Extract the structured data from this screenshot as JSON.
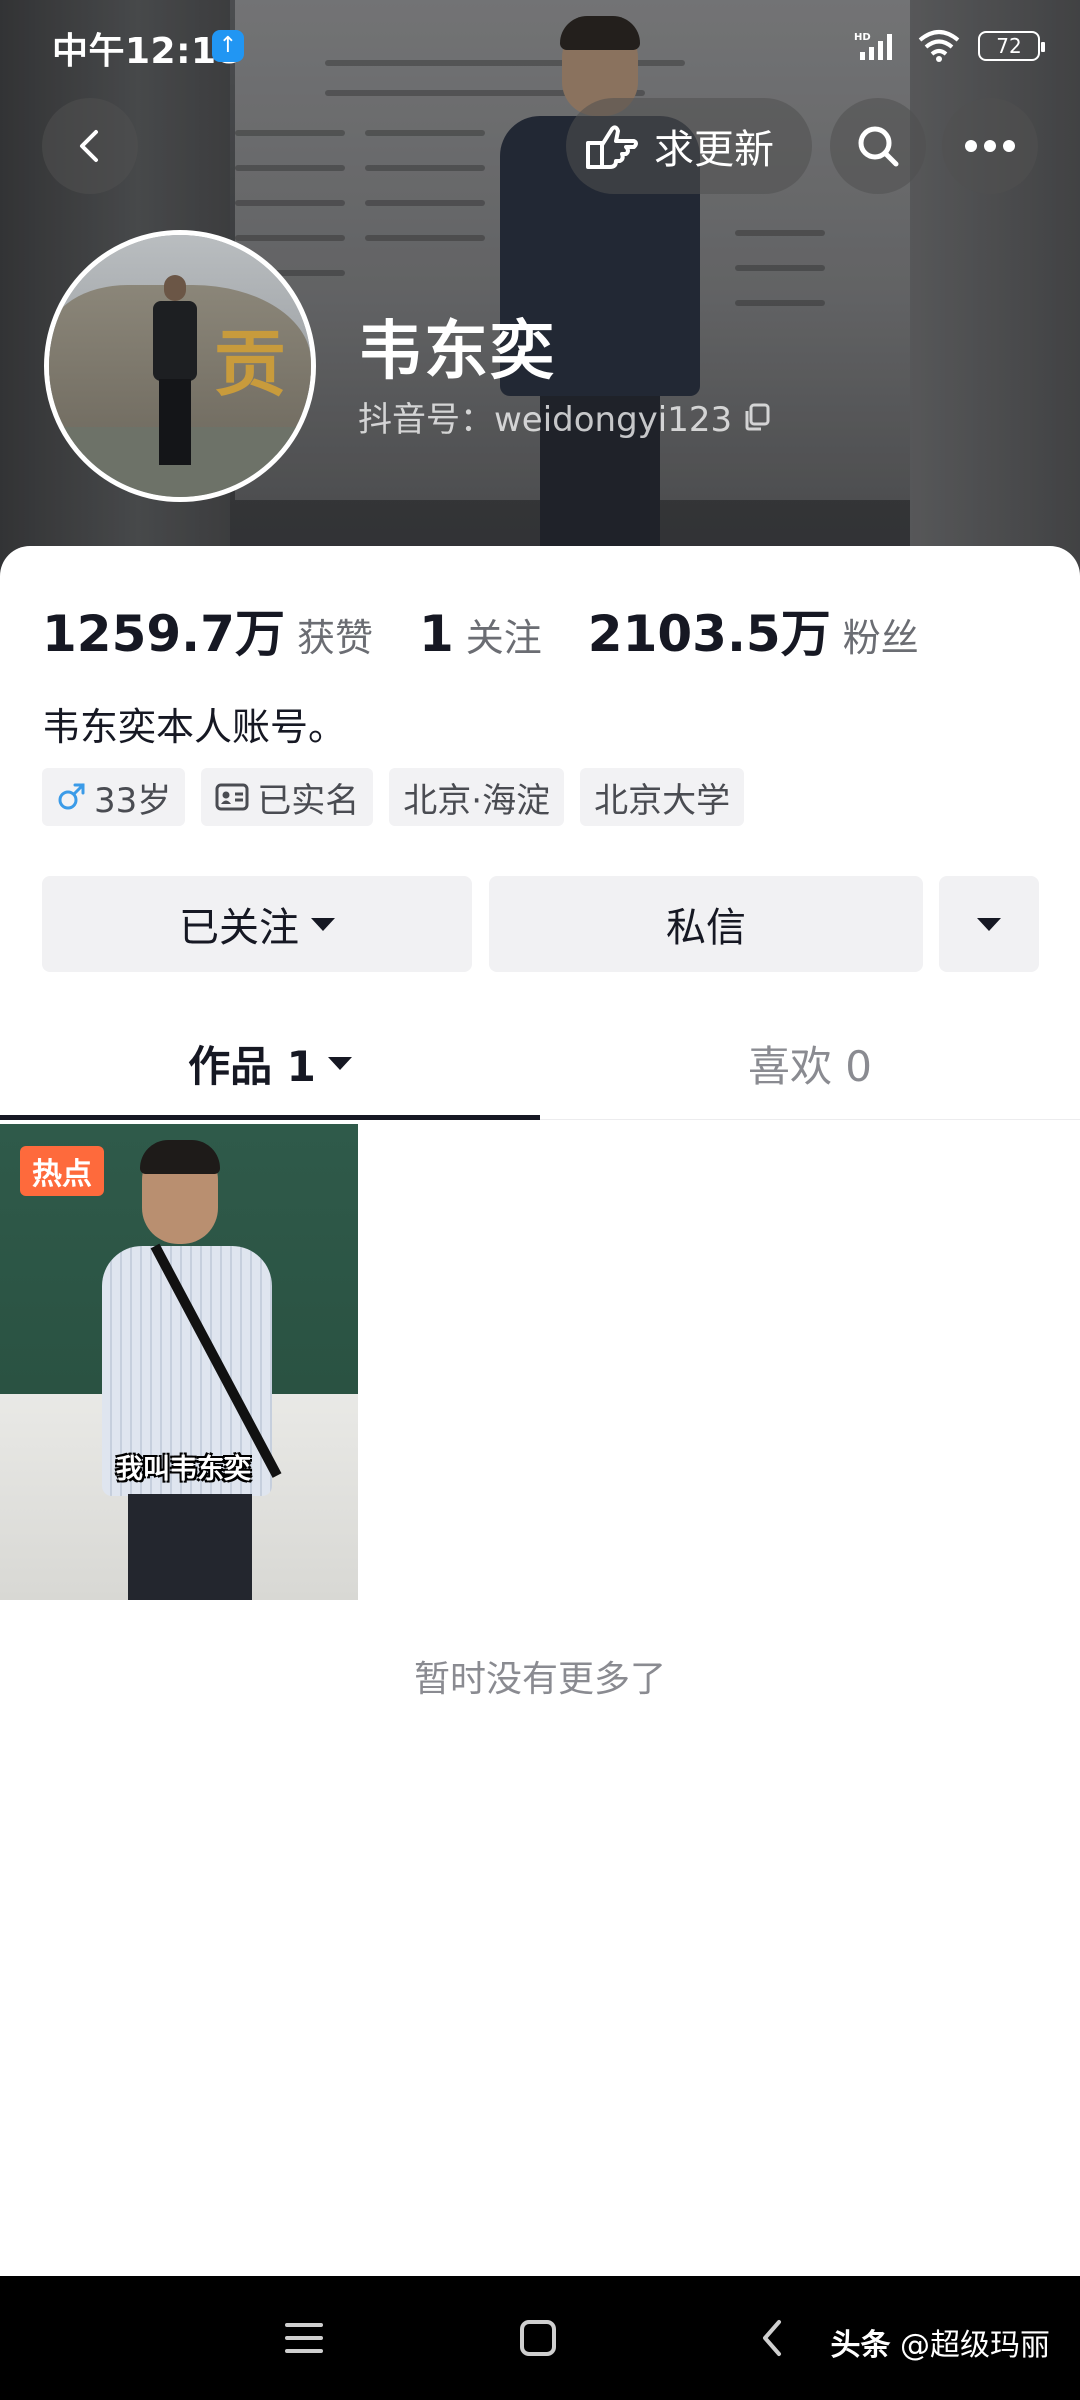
{
  "status_bar": {
    "time": "中午12:18",
    "battery": "72"
  },
  "header": {
    "request_update_label": "求更新",
    "name": "韦东奕",
    "douyin_id": "抖音号：weidongyi123"
  },
  "stats": {
    "likes_value": "1259.7万",
    "likes_label": "获赞",
    "following_value": "1",
    "following_label": "关注",
    "followers_value": "2103.5万",
    "followers_label": "粉丝"
  },
  "bio": "韦东奕本人账号。",
  "tags": {
    "age": "33岁",
    "verified": "已实名",
    "location": "北京·海淀",
    "school": "北京大学"
  },
  "actions": {
    "following_label": "已关注",
    "message_label": "私信"
  },
  "tabs": {
    "works_label": "作品 1",
    "likes_label": "喜欢 0"
  },
  "video": {
    "badge": "热点",
    "caption": "我叫韦东奕"
  },
  "footer_text": "暂时没有更多了",
  "watermark": {
    "prefix": "头条",
    "handle": "@超级玛丽"
  },
  "colors": {
    "text_primary": "#161823",
    "text_secondary": "#8a8b91",
    "hot_badge": "#fe6a3c",
    "button_bg": "#f1f1f3",
    "gender_male": "#3b9be8"
  },
  "icons": {
    "back": "chevron-left-icon",
    "request_update": "hand-point-icon",
    "search": "search-icon",
    "more": "more-dots-icon",
    "copy": "copy-icon",
    "gender": "male-icon",
    "id_card": "id-card-icon",
    "nav_menu": "menu-icon",
    "nav_home": "home-square-icon",
    "nav_back": "nav-back-icon"
  }
}
